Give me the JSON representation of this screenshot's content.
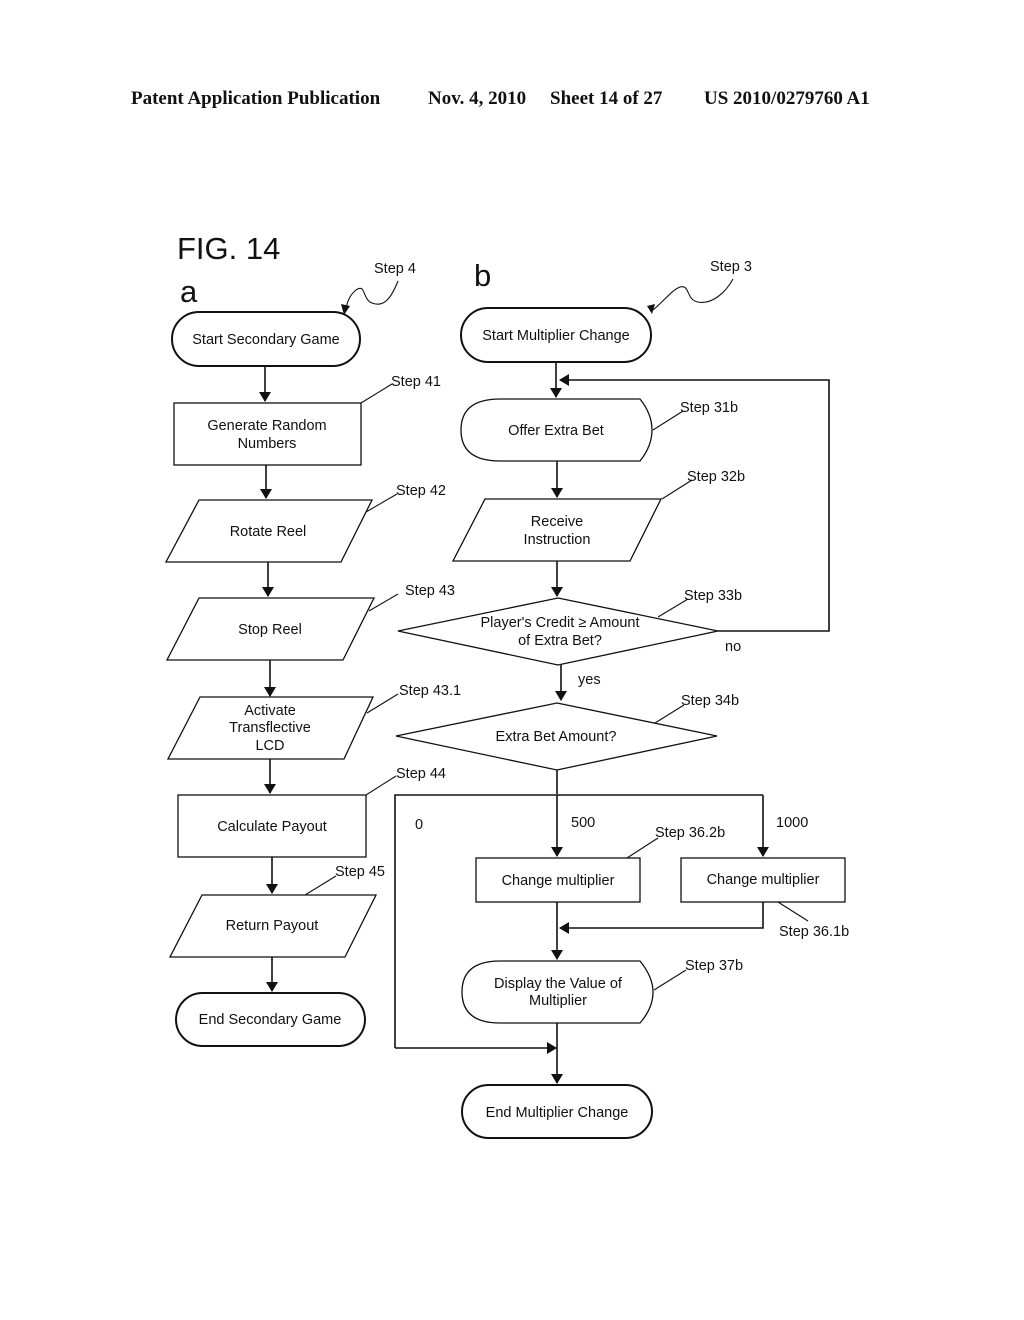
{
  "header": {
    "publication": "Patent Application Publication",
    "date": "Nov. 4, 2010",
    "sheet": "Sheet 14 of 27",
    "number": "US 2010/0279760 A1"
  },
  "figure": {
    "title": "FIG. 14",
    "panel_a": {
      "letter": "a",
      "entry_ref": "Step 4",
      "nodes": [
        {
          "id": "start",
          "shape": "terminator",
          "lines": [
            "Start Secondary Game"
          ]
        },
        {
          "id": "s41",
          "shape": "process",
          "lines": [
            "Generate Random",
            "Numbers"
          ],
          "ref": "Step 41"
        },
        {
          "id": "s42",
          "shape": "data",
          "lines": [
            "Rotate Reel"
          ],
          "ref": "Step 42"
        },
        {
          "id": "s43",
          "shape": "data",
          "lines": [
            "Stop Reel"
          ],
          "ref": "Step 43"
        },
        {
          "id": "s431",
          "shape": "data",
          "lines": [
            "Activate",
            "Transflective",
            "LCD"
          ],
          "ref": "Step 43.1"
        },
        {
          "id": "s44",
          "shape": "process",
          "lines": [
            "Calculate Payout"
          ],
          "ref": "Step 44"
        },
        {
          "id": "s45",
          "shape": "data",
          "lines": [
            "Return Payout"
          ],
          "ref": "Step 45"
        },
        {
          "id": "end",
          "shape": "terminator",
          "lines": [
            "End Secondary Game"
          ]
        }
      ]
    },
    "panel_b": {
      "letter": "b",
      "entry_ref": "Step 3",
      "nodes": [
        {
          "id": "start",
          "shape": "terminator",
          "lines": [
            "Start Multiplier Change"
          ]
        },
        {
          "id": "s31b",
          "shape": "display",
          "lines": [
            "Offer Extra Bet"
          ],
          "ref": "Step 31b"
        },
        {
          "id": "s32b",
          "shape": "data",
          "lines": [
            "Receive",
            "Instruction"
          ],
          "ref": "Step 32b"
        },
        {
          "id": "s33b",
          "shape": "decision",
          "lines": [
            "Player's Credit ≥ Amount",
            "of Extra Bet?"
          ],
          "ref": "Step 33b"
        },
        {
          "id": "s34b",
          "shape": "decision",
          "lines": [
            "Extra Bet Amount?"
          ],
          "ref": "Step 34b"
        },
        {
          "id": "s362b",
          "shape": "process",
          "lines": [
            "Change multiplier"
          ],
          "ref": "Step 36.2b"
        },
        {
          "id": "s361b",
          "shape": "process",
          "lines": [
            "Change multiplier"
          ],
          "ref": "Step 36.1b"
        },
        {
          "id": "s37b",
          "shape": "display",
          "lines": [
            "Display the Value of",
            "Multiplier"
          ],
          "ref": "Step 37b"
        },
        {
          "id": "end",
          "shape": "terminator",
          "lines": [
            "End Multiplier Change"
          ]
        }
      ],
      "edge_labels": {
        "no": "no",
        "yes": "yes",
        "branch_0": "0",
        "branch_500": "500",
        "branch_1000": "1000"
      }
    }
  }
}
